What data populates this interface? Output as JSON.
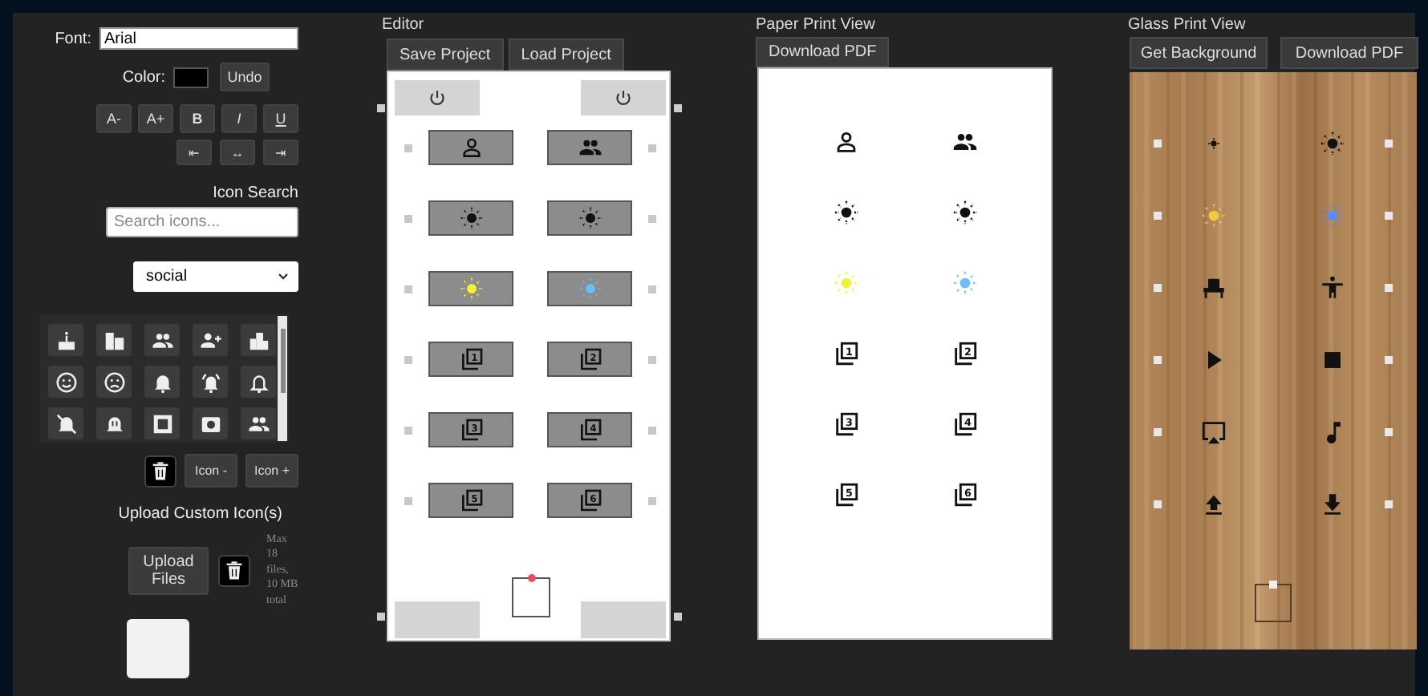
{
  "sidebar": {
    "font_label": "Font:",
    "font_value": "Arial",
    "color_label": "Color:",
    "color": "#000000",
    "undo": "Undo",
    "format_buttons": [
      "A-",
      "A+",
      "B",
      "I",
      "U"
    ],
    "align_buttons": [
      "⇤",
      "↔",
      "⇥"
    ],
    "icon_search_label": "Icon Search",
    "search_placeholder": "Search icons...",
    "category": "social",
    "palette": [
      {
        "kind": "cake"
      },
      {
        "kind": "apartment"
      },
      {
        "kind": "group"
      },
      {
        "kind": "group-add"
      },
      {
        "kind": "city"
      },
      {
        "kind": "mood"
      },
      {
        "kind": "mood-bad"
      },
      {
        "kind": "bell"
      },
      {
        "kind": "bell-ring"
      },
      {
        "kind": "bell-outline"
      },
      {
        "kind": "bell-off"
      },
      {
        "kind": "bell-pause"
      },
      {
        "kind": "frame"
      },
      {
        "kind": "camera"
      },
      {
        "kind": "group"
      }
    ],
    "icon_minus": "Icon -",
    "icon_plus": "Icon +",
    "upload_label": "Upload Custom Icon(s)",
    "upload_button": "Upload Files",
    "limit_note": "Max 18 files, 10 MB total"
  },
  "editor": {
    "title": "Editor",
    "buttons": [
      "Save Project",
      "Load Project"
    ],
    "cells": [
      {
        "kind": "person"
      },
      {
        "kind": "group"
      },
      {
        "kind": "sun"
      },
      {
        "kind": "sun"
      },
      {
        "kind": "sun",
        "color": "#f2f03a"
      },
      {
        "kind": "sun",
        "color": "#6cbcf5"
      },
      {
        "kind": "filter",
        "number": "1"
      },
      {
        "kind": "filter",
        "number": "2"
      },
      {
        "kind": "filter",
        "number": "3"
      },
      {
        "kind": "filter",
        "number": "4"
      },
      {
        "kind": "filter",
        "number": "5"
      },
      {
        "kind": "filter",
        "number": "6"
      }
    ]
  },
  "paper": {
    "title": "Paper Print View",
    "button": "Download PDF",
    "cells": [
      {
        "kind": "person"
      },
      {
        "kind": "group"
      },
      {
        "kind": "sun"
      },
      {
        "kind": "sun"
      },
      {
        "kind": "sun",
        "color": "#f2f03a"
      },
      {
        "kind": "sun",
        "color": "#6cbcf5"
      },
      {
        "kind": "filter",
        "number": "1"
      },
      {
        "kind": "filter",
        "number": "2"
      },
      {
        "kind": "filter",
        "number": "3"
      },
      {
        "kind": "filter",
        "number": "4"
      },
      {
        "kind": "filter",
        "number": "5"
      },
      {
        "kind": "filter",
        "number": "6"
      }
    ]
  },
  "glass": {
    "title": "Glass Print View",
    "buttons": [
      "Get Background",
      "Download PDF"
    ],
    "cells": [
      {
        "kind": "sun-small"
      },
      {
        "kind": "sun"
      },
      {
        "kind": "sun",
        "color": "#f5c93a"
      },
      {
        "kind": "sun",
        "color": "#5b8cff"
      },
      {
        "kind": "seat"
      },
      {
        "kind": "accessibility"
      },
      {
        "kind": "play"
      },
      {
        "kind": "stop"
      },
      {
        "kind": "airplay"
      },
      {
        "kind": "music"
      },
      {
        "kind": "upload"
      },
      {
        "kind": "download"
      }
    ]
  }
}
